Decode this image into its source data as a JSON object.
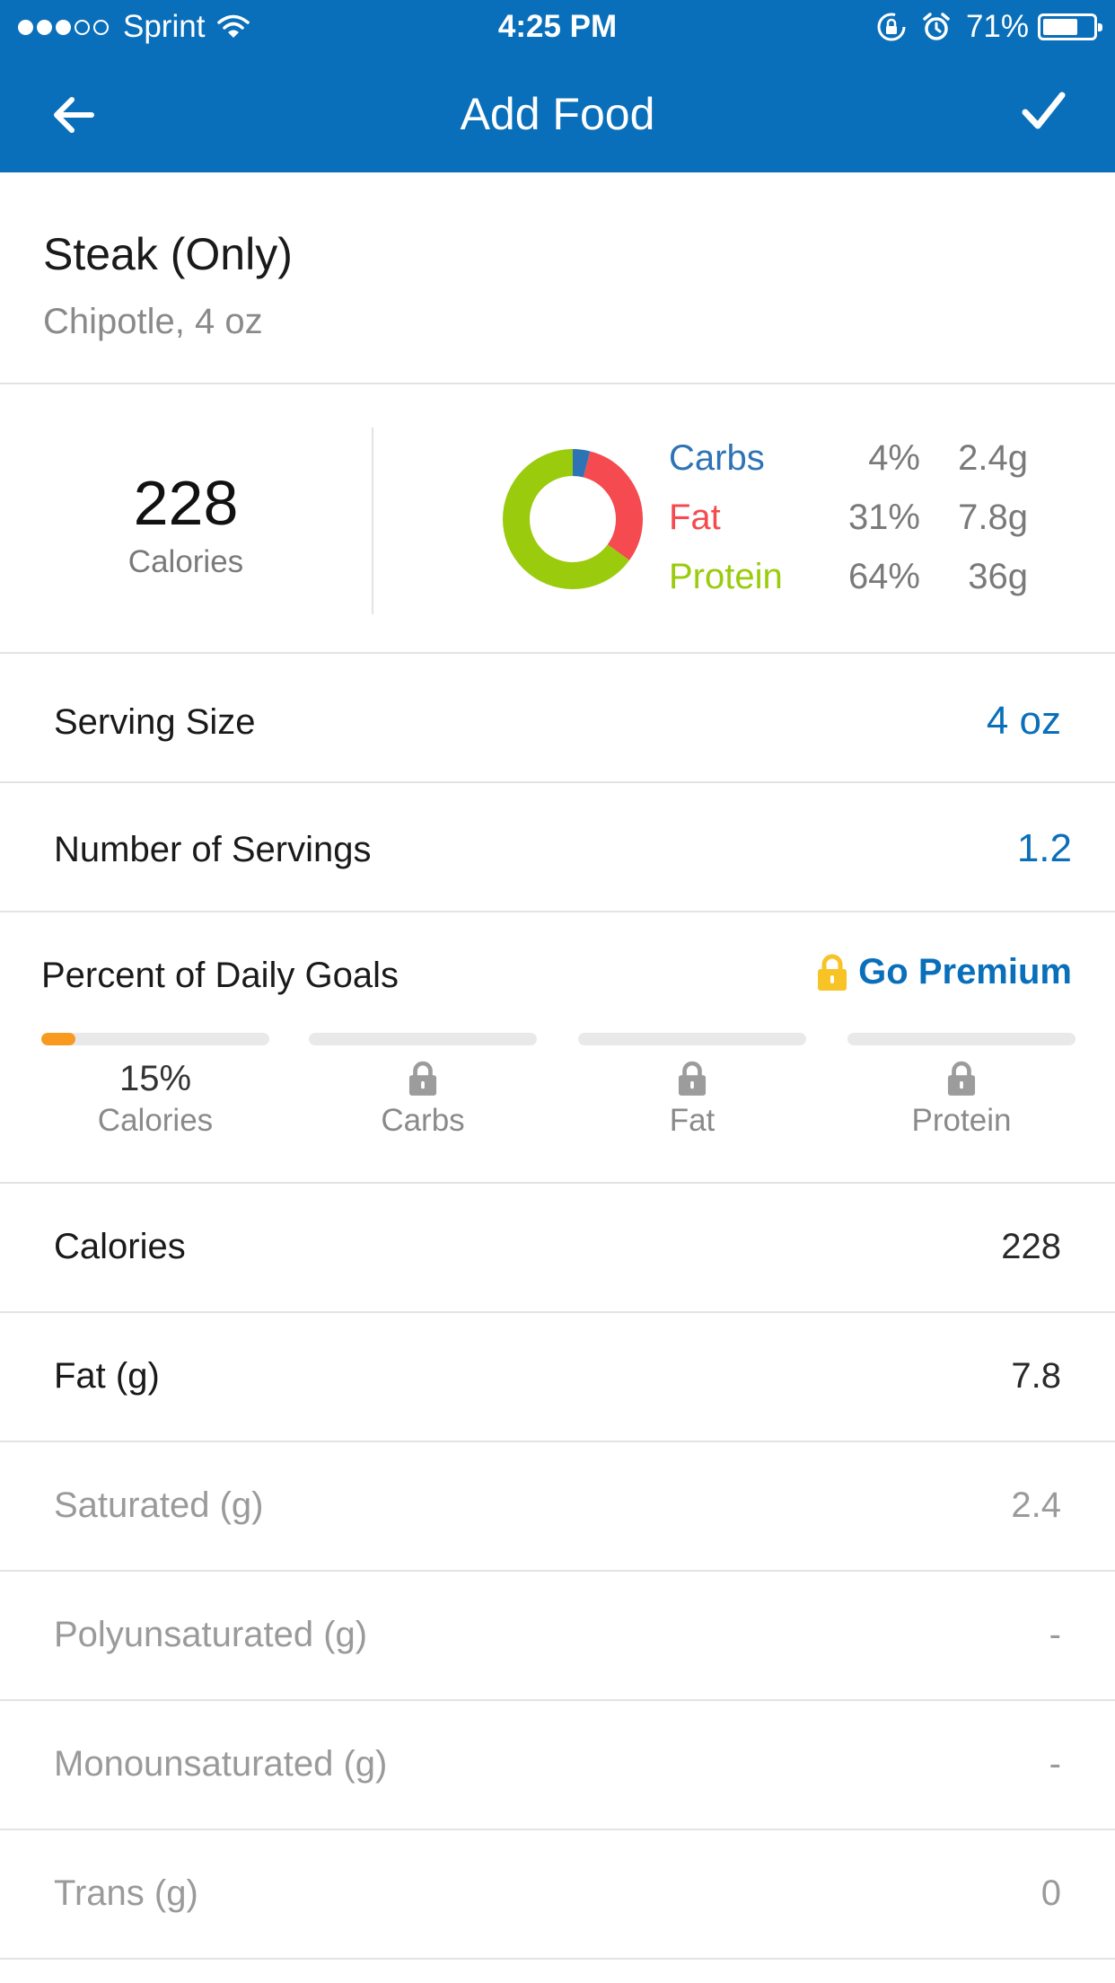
{
  "status_bar": {
    "signal_dots_filled": 3,
    "signal_dots_total": 5,
    "carrier": "Sprint",
    "time": "4:25 PM",
    "battery": "71%",
    "battery_level": 0.71
  },
  "nav": {
    "title": "Add Food",
    "back_icon": "arrow-left-icon",
    "confirm_icon": "checkmark-icon",
    "color": "#0a6fba"
  },
  "food": {
    "name": "Steak (Only)",
    "subtitle": "Chipotle, 4 oz"
  },
  "summary": {
    "calories": "228",
    "calories_label": "Calories",
    "macros": [
      {
        "name": "Carbs",
        "percent": "4%",
        "grams": "2.4g",
        "color": "#2e74b5",
        "fraction": 0.04
      },
      {
        "name": "Fat",
        "percent": "31%",
        "grams": "7.8g",
        "color": "#f54a4f",
        "fraction": 0.31
      },
      {
        "name": "Protein",
        "percent": "64%",
        "grams": "36g",
        "color": "#9acb0d",
        "fraction": 0.65
      }
    ]
  },
  "serving": {
    "serving_size_label": "Serving Size",
    "serving_size_value": "4 oz",
    "servings_label": "Number of Servings",
    "servings_value": "1.2"
  },
  "daily_goals": {
    "title": "Percent of Daily Goals",
    "premium_label": "Go Premium",
    "premium_icon": "lock-icon",
    "accent": "#f79a1f",
    "items": [
      {
        "label": "Calories",
        "percent": "15%",
        "fill": 0.15,
        "locked": false
      },
      {
        "label": "Carbs",
        "locked": true
      },
      {
        "label": "Fat",
        "locked": true
      },
      {
        "label": "Protein",
        "locked": true
      }
    ]
  },
  "nutrition": [
    {
      "label": "Calories",
      "value": "228",
      "sub": false
    },
    {
      "label": "Fat (g)",
      "value": "7.8",
      "sub": false
    },
    {
      "label": "Saturated (g)",
      "value": "2.4",
      "sub": true
    },
    {
      "label": "Polyunsaturated (g)",
      "value": "-",
      "sub": true
    },
    {
      "label": "Monounsaturated (g)",
      "value": "-",
      "sub": true
    },
    {
      "label": "Trans (g)",
      "value": "0",
      "sub": true
    }
  ]
}
